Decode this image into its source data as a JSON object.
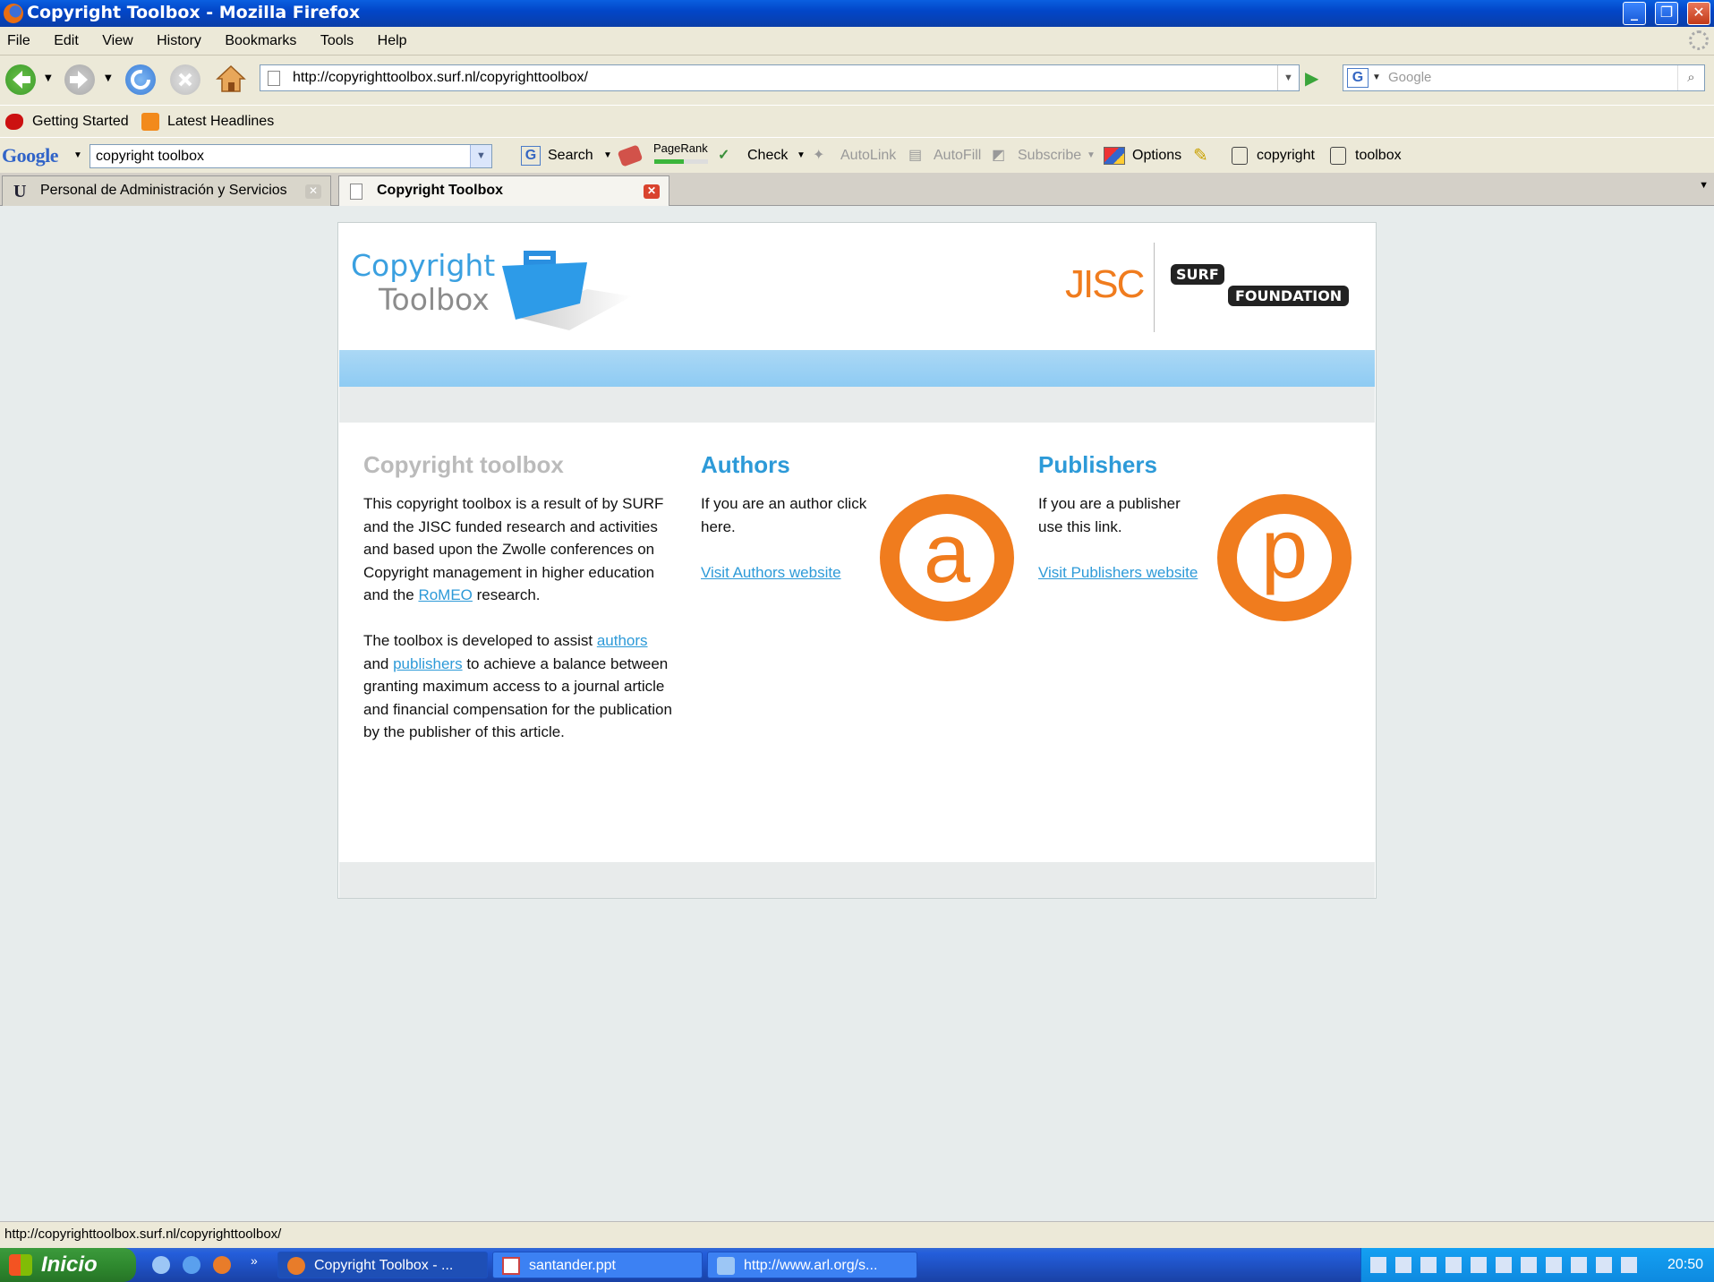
{
  "window": {
    "title": "Copyright Toolbox - Mozilla Firefox"
  },
  "menu": [
    "File",
    "Edit",
    "View",
    "History",
    "Bookmarks",
    "Tools",
    "Help"
  ],
  "nav": {
    "url": "http://copyrighttoolbox.surf.nl/copyrighttoolbox/",
    "search_placeholder": "Google"
  },
  "bookmarks": [
    "Getting Started",
    "Latest Headlines"
  ],
  "google_toolbar": {
    "logo": "Google",
    "query": "copyright toolbox",
    "search_label": "Search",
    "pagerank_label": "PageRank",
    "check_label": "Check",
    "autolink_label": "AutoLink",
    "autofill_label": "AutoFill",
    "subscribe_label": "Subscribe",
    "options_label": "Options",
    "term1": "copyright",
    "term2": "toolbox"
  },
  "tabs": [
    {
      "label": "Personal de Administración y Servicios",
      "active": false
    },
    {
      "label": "Copyright Toolbox",
      "active": true
    }
  ],
  "page": {
    "logo_line1": "Copyright",
    "logo_line2": "Toolbox",
    "jisc": "JISC",
    "surf": "SURF",
    "foundation": "FOUNDATION",
    "intro": {
      "heading": "Copyright toolbox",
      "p1_before": "This copyright toolbox is a result of by SURF and the JISC funded research and activities and based upon the Zwolle conferences on Copyright management in higher education and the ",
      "p1_link": "RoMEO",
      "p1_after": " research.",
      "p2_before": "The toolbox is developed to assist ",
      "p2_link1": "authors",
      "p2_mid": " and ",
      "p2_link2": "publishers",
      "p2_after": " to achieve a balance between granting maximum access to a journal article and financial compensation for the publication by the publisher of this article."
    },
    "authors": {
      "heading": "Authors",
      "text": "If you are an author click here.",
      "link": "Visit Authors website",
      "badge": "a"
    },
    "publishers": {
      "heading": "Publishers",
      "text": "If you are a publisher use this link.",
      "link": "Visit Publishers website",
      "badge": "p"
    }
  },
  "status": "http://copyrighttoolbox.surf.nl/copyrighttoolbox/",
  "taskbar": {
    "start": "Inicio",
    "tasks": [
      "Copyright Toolbox - ...",
      "santander.ppt",
      "http://www.arl.org/s..."
    ],
    "clock": "20:50"
  },
  "colors": {
    "accent_blue": "#2d9ad8",
    "badge_orange": "#f07c1e",
    "jisc_orange": "#f07c1e"
  }
}
